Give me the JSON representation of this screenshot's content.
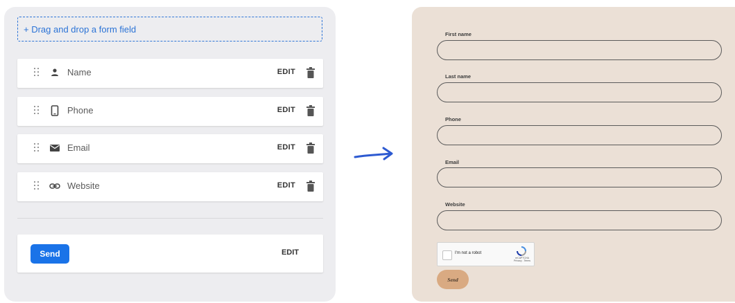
{
  "builder": {
    "dropzone_label": "+ Drag and drop a form field",
    "fields": [
      {
        "label": "Name",
        "icon": "person-icon",
        "edit": "EDIT"
      },
      {
        "label": "Phone",
        "icon": "phone-icon",
        "edit": "EDIT"
      },
      {
        "label": "Email",
        "icon": "mail-icon",
        "edit": "EDIT"
      },
      {
        "label": "Website",
        "icon": "link-icon",
        "edit": "EDIT"
      }
    ],
    "send_button": "Send",
    "send_edit": "EDIT"
  },
  "preview": {
    "fields": [
      {
        "label": "First name"
      },
      {
        "label": "Last name"
      },
      {
        "label": "Phone"
      },
      {
        "label": "Email"
      },
      {
        "label": "Website"
      }
    ],
    "captcha": {
      "text": "I'm not a robot",
      "brand_line1": "reCAPTCHA",
      "brand_line2": "Privacy - Terms"
    },
    "send_button": "Send"
  },
  "colors": {
    "builder_bg": "#ededf0",
    "accent_blue": "#1a73e8",
    "preview_bg": "#ebe0d6",
    "preview_send": "#d9aa82"
  }
}
